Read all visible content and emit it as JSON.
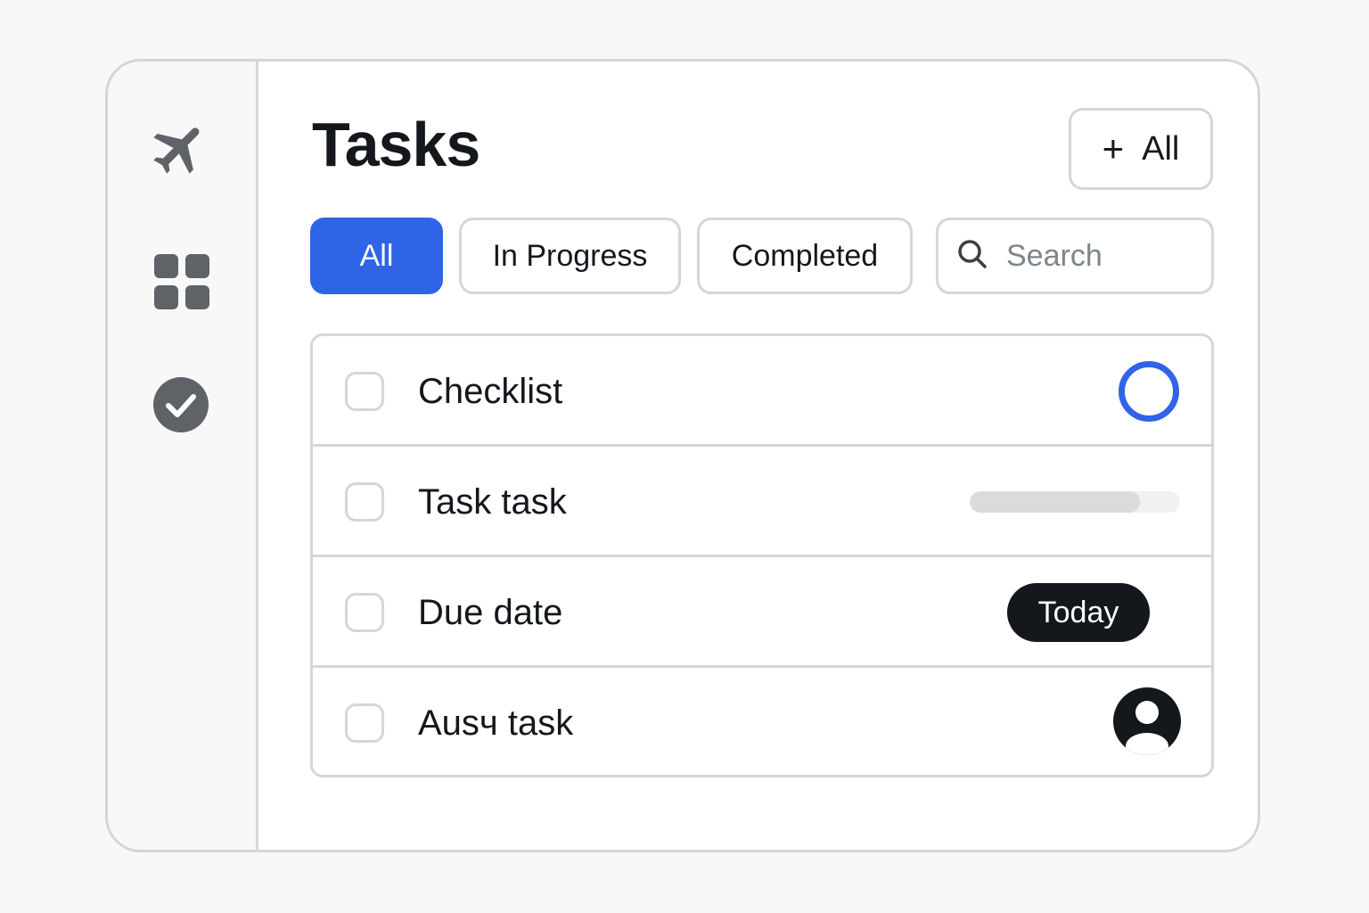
{
  "header": {
    "title": "Tasks",
    "add_button_icon": "plus-icon",
    "add_button_label": "All"
  },
  "sidebar": {
    "items": [
      {
        "icon": "airplane-icon",
        "color": "#5f6368"
      },
      {
        "icon": "grid-icon",
        "color": "#5f6368"
      },
      {
        "icon": "check-circle-icon",
        "color": "#5f6368"
      }
    ]
  },
  "filters": {
    "tabs": [
      {
        "label": "All",
        "active": true
      },
      {
        "label": "In Progress",
        "active": false
      },
      {
        "label": "Completed",
        "active": false
      }
    ],
    "search": {
      "icon": "search-icon",
      "placeholder": "Search",
      "value": ""
    }
  },
  "tasks": [
    {
      "label": "Checklist",
      "checked": false,
      "indicator": "status-ring"
    },
    {
      "label": "Task task",
      "checked": false,
      "indicator": "progress-bar",
      "progress": 0.81
    },
    {
      "label": "Due date",
      "checked": false,
      "indicator": "due-badge",
      "badge": "Today"
    },
    {
      "label": "Ausч task",
      "checked": false,
      "indicator": "avatar",
      "avatar_icon": "user-icon"
    }
  ],
  "colors": {
    "accent": "#2f64e6",
    "text": "#14181c",
    "border": "#d6d6d6",
    "muted": "#7d858c"
  }
}
